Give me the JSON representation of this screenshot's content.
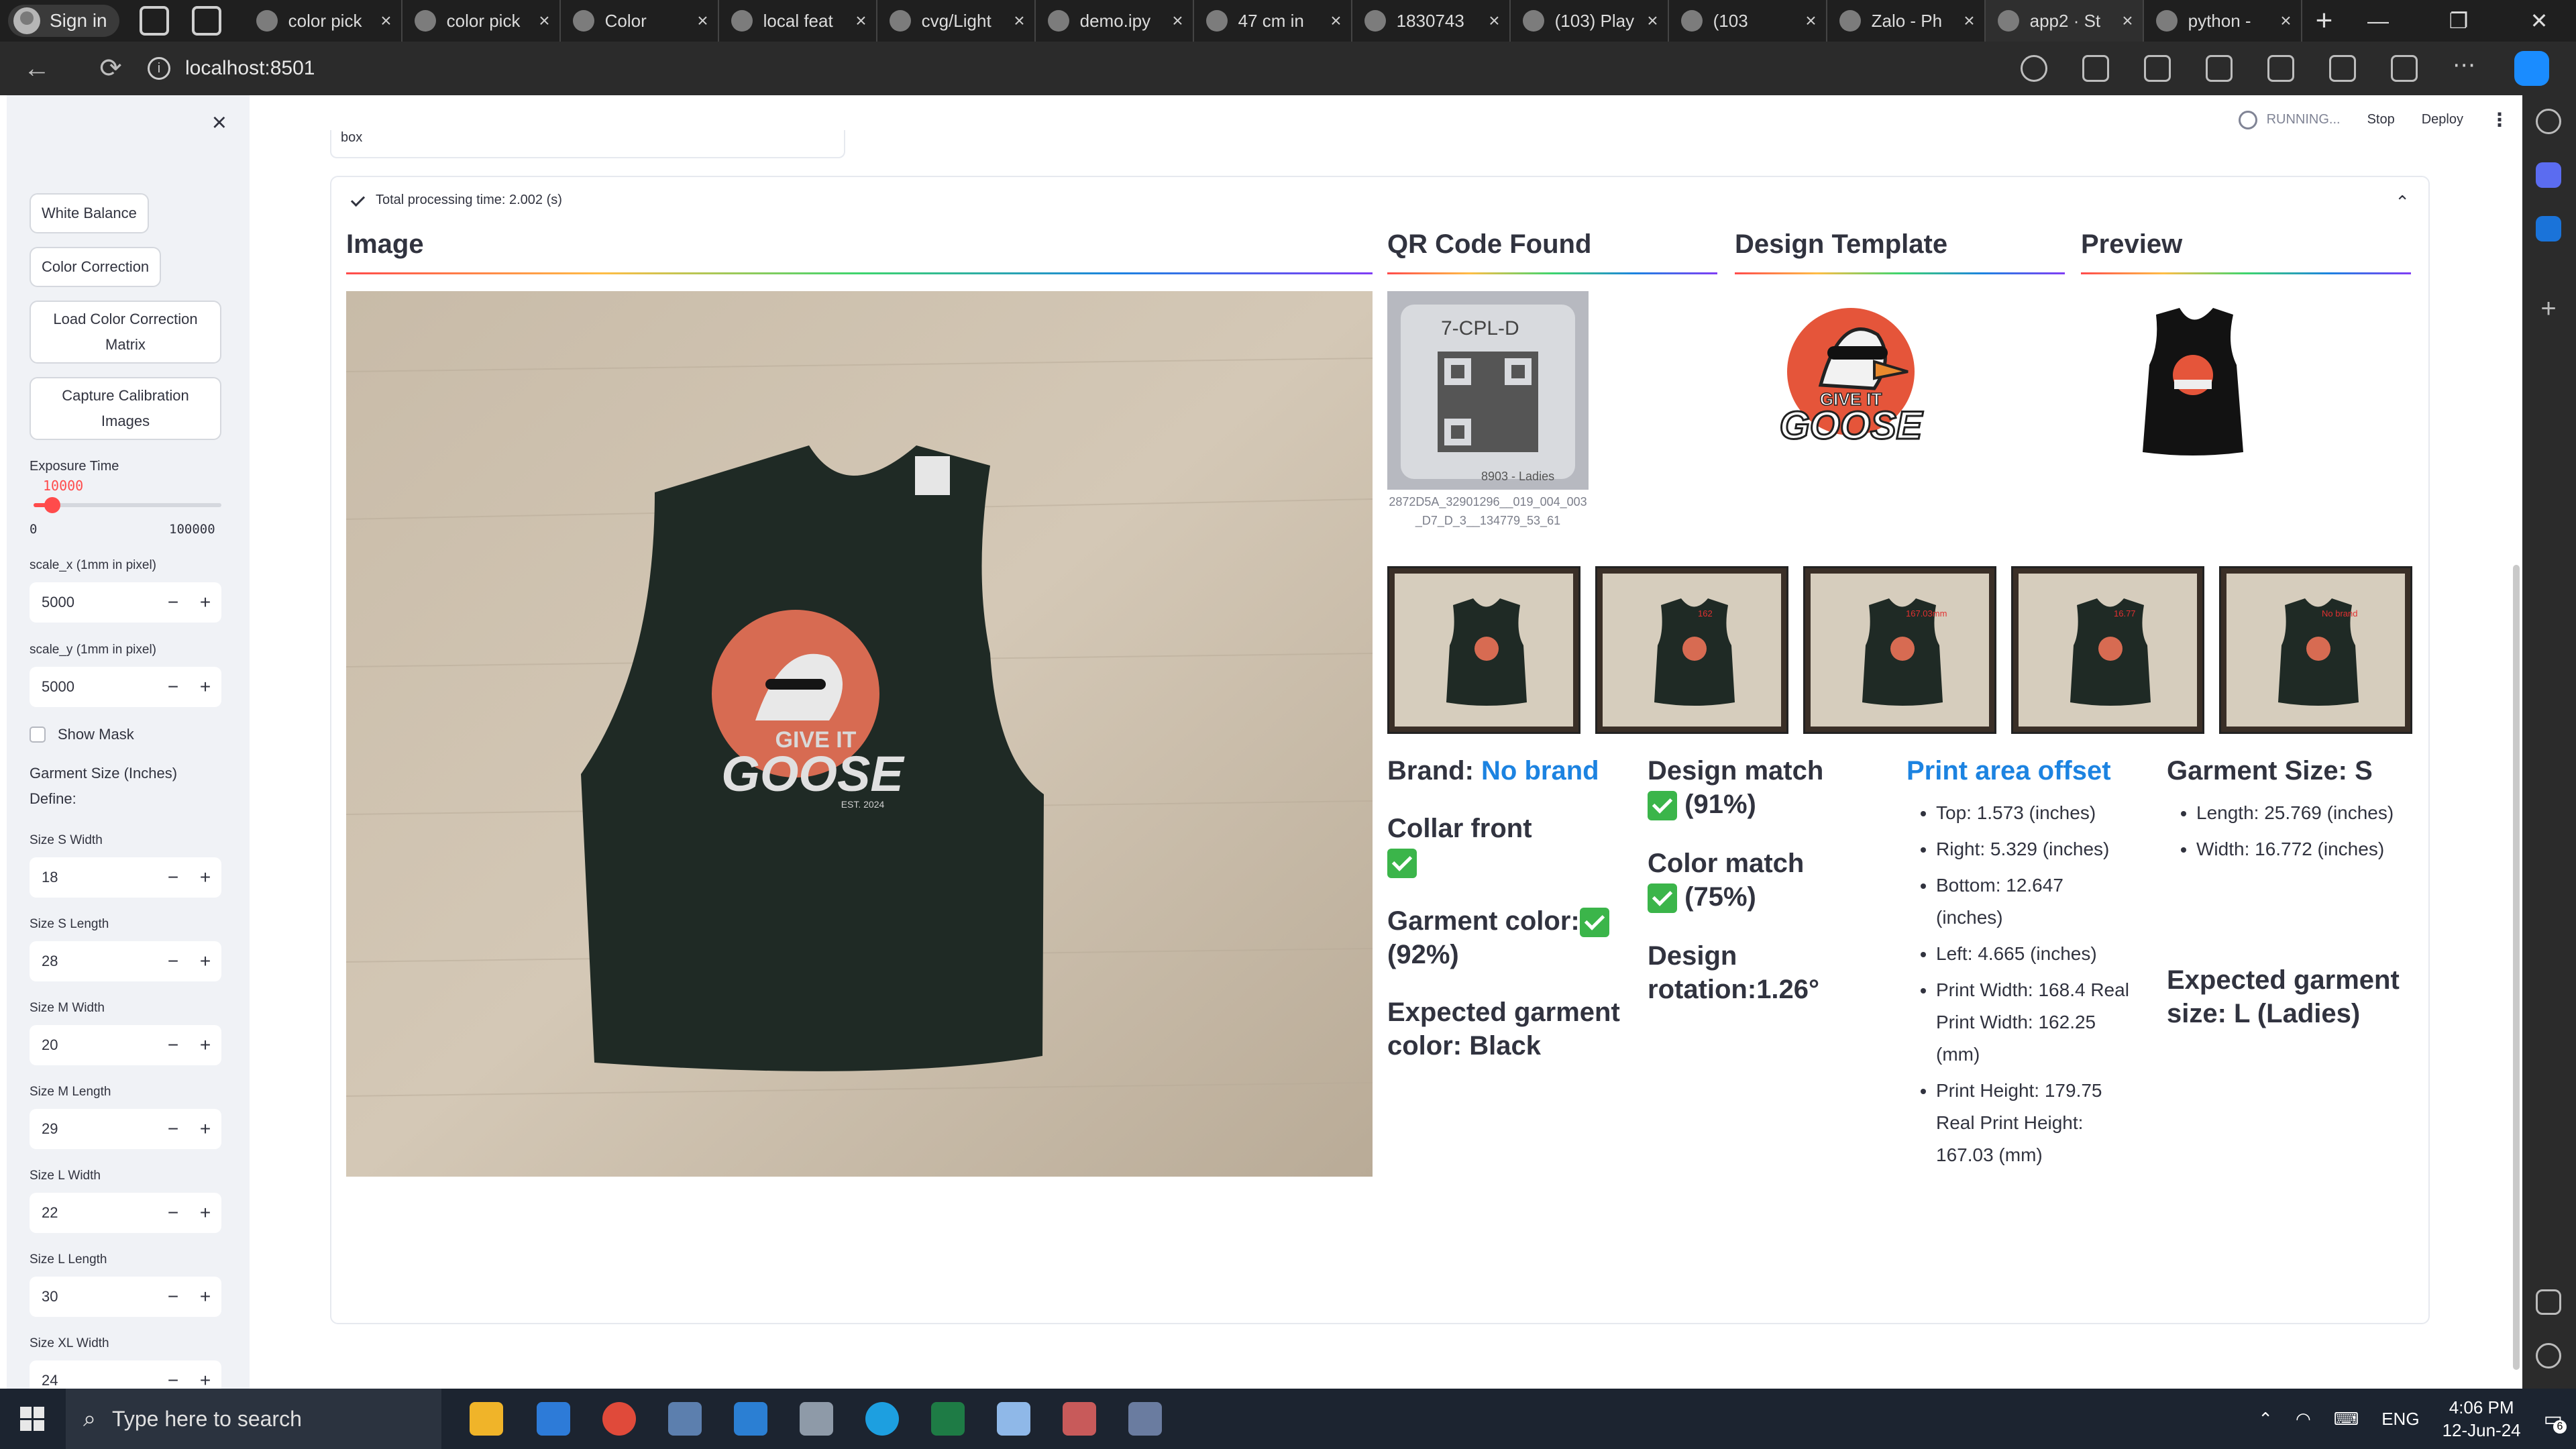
{
  "browser": {
    "profile_label": "Sign in",
    "tabs": [
      {
        "title": "color pick",
        "active": false
      },
      {
        "title": "color pick",
        "active": false
      },
      {
        "title": "Color",
        "active": false
      },
      {
        "title": "local feat",
        "active": false
      },
      {
        "title": "cvg/Light",
        "active": false
      },
      {
        "title": "demo.ipy",
        "active": false
      },
      {
        "title": "47 cm in",
        "active": false
      },
      {
        "title": "1830743",
        "active": false
      },
      {
        "title": "(103) Play",
        "active": false
      },
      {
        "title": "(103",
        "active": false
      },
      {
        "title": "Zalo - Ph",
        "active": false
      },
      {
        "title": "app2 · St",
        "active": true
      },
      {
        "title": "python -",
        "active": false
      }
    ],
    "tab_close": "×",
    "new_tab": "+",
    "url": "localhost:8501",
    "win_min": "—",
    "win_restore": "❐",
    "win_close": "✕",
    "back": "←",
    "reload": "⟳"
  },
  "sidebar": {
    "close": "×",
    "buttons": {
      "white_balance": "White Balance",
      "color_correction": "Color Correction",
      "load_ccm": "Load Color Correction Matrix",
      "capture_calib": "Capture Calibration Images"
    },
    "exposure": {
      "label": "Exposure Time",
      "value": "10000",
      "min": "0",
      "max": "100000",
      "fraction": 0.1
    },
    "scale_x": {
      "label": "scale_x (1mm in pixel)",
      "value": "5000"
    },
    "scale_y": {
      "label": "scale_y (1mm in pixel)",
      "value": "5000"
    },
    "show_mask": "Show Mask",
    "garment_size_heading": "Garment Size (Inches)",
    "define": "Define:",
    "sizes": [
      {
        "label": "Size S Width",
        "value": "18"
      },
      {
        "label": "Size S Length",
        "value": "28"
      },
      {
        "label": "Size M Width",
        "value": "20"
      },
      {
        "label": "Size M Length",
        "value": "29"
      },
      {
        "label": "Size L Width",
        "value": "22"
      },
      {
        "label": "Size L Length",
        "value": "30"
      },
      {
        "label": "Size XL Width",
        "value": "24"
      }
    ],
    "minus": "−",
    "plus": "+"
  },
  "main": {
    "status": "RUNNING...",
    "stop": "Stop",
    "deploy": "Deploy",
    "menu": "⋮",
    "prev_field_text": "box",
    "expander_label": "Total processing time: 2.002 (s)",
    "expander_caret": "⌃",
    "headers": {
      "image": "Image",
      "qr": "QR Code Found",
      "design": "Design Template",
      "preview": "Preview"
    },
    "qr_caption": "2872D5A_32901296__019_004_003_D7_D_3__134779_53_61",
    "qr_label_text": "7-CPL-D",
    "qr_bottom_text": "8903 - Ladies",
    "logo_text_top": "GIVE IT",
    "logo_text_main": "GOOSE",
    "logo_text_est": "EST. 2024",
    "brand": {
      "label": "Brand:",
      "value": "No brand"
    },
    "collar": "Collar front",
    "garment_color": {
      "label": "Garment color:",
      "pct": "(92%)"
    },
    "expected_color": "Expected garment color: Black",
    "design_match": {
      "label": "Design match",
      "pct": "(91%)"
    },
    "color_match": {
      "label": "Color match",
      "pct": "(75%)"
    },
    "rotation": "Design rotation:1.26°",
    "print_offset": {
      "title": "Print area offset",
      "items": [
        "Top: 1.573 (inches)",
        "Right: 5.329 (inches)",
        "Bottom: 12.647 (inches)",
        "Left: 4.665 (inches)",
        "Print Width: 168.4 Real Print Width: 162.25 (mm)",
        "Print Height: 179.75 Real Print Height: 167.03 (mm)"
      ]
    },
    "garment_size": {
      "title": "Garment Size: S",
      "items": [
        "Length: 25.769 (inches)",
        "Width: 16.772 (inches)"
      ],
      "expected": "Expected garment size: L (Ladies)"
    },
    "thumb_annotations": [
      "",
      "162",
      "167.03mm",
      "16.77",
      "No brand"
    ]
  },
  "taskbar": {
    "search_placeholder": "Type here to search",
    "lang": "ENG",
    "time": "4:06 PM",
    "date": "12-Jun-24",
    "notif_count": "6"
  },
  "colors": {
    "accent": "#ff4b4b",
    "link": "#1c83e1",
    "shirt": "#1f2a25",
    "check_green": "#3bb54a"
  }
}
